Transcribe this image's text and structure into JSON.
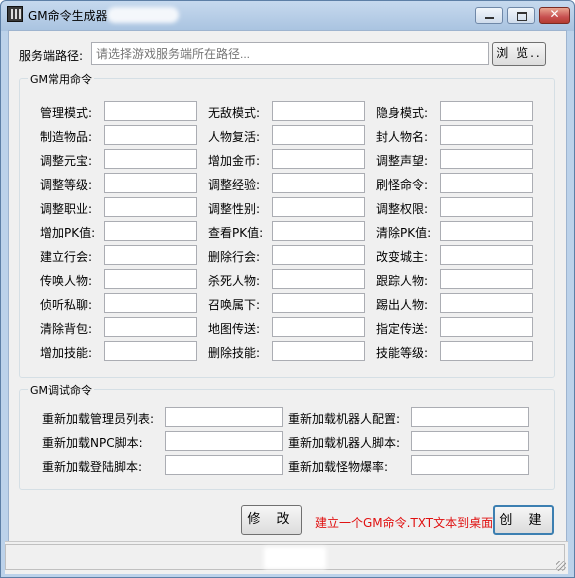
{
  "window": {
    "title": "GM命令生成器"
  },
  "path": {
    "label": "服务端路径:",
    "placeholder": "请选择游戏服务端所在路径...",
    "browse_label": "浏 览.."
  },
  "common_group": {
    "title": "GM常用命令",
    "columns": [
      [
        "管理模式:",
        "制造物品:",
        "调整元宝:",
        "调整等级:",
        "调整职业:",
        "增加PK值:",
        "建立行会:",
        "传唤人物:",
        "侦听私聊:",
        "清除背包:",
        "增加技能:"
      ],
      [
        "无敌模式:",
        "人物复活:",
        "增加金币:",
        "调整经验:",
        "调整性别:",
        "查看PK值:",
        "删除行会:",
        "杀死人物:",
        "召唤属下:",
        "地图传送:",
        "删除技能:"
      ],
      [
        "隐身模式:",
        "封人物名:",
        "调整声望:",
        "刷怪命令:",
        "调整权限:",
        "清除PK值:",
        "改变城主:",
        "跟踪人物:",
        "踢出人物:",
        "指定传送:",
        "技能等级:"
      ]
    ]
  },
  "debug_group": {
    "title": "GM调试命令",
    "left": [
      "重新加载管理员列表:",
      "重新加载NPC脚本:",
      "重新加载登陆脚本:"
    ],
    "right": [
      "重新加载机器人配置:",
      "重新加载机器人脚本:",
      "重新加载怪物爆率:"
    ]
  },
  "actions": {
    "modify_label": "修 改",
    "hint": "建立一个GM命令.TXT文本到桌面",
    "create_label": "创 建"
  }
}
